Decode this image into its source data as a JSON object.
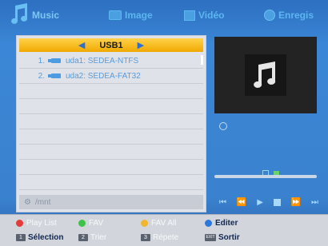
{
  "tabs": [
    {
      "label": "Music",
      "icon": "music-note-icon"
    },
    {
      "label": "Image",
      "icon": "image-icon"
    },
    {
      "label": "Vidéo",
      "icon": "video-icon"
    },
    {
      "label": "Enregis",
      "icon": "record-icon"
    }
  ],
  "device": {
    "label": "USB1"
  },
  "files": [
    {
      "index": "1.",
      "name": "uda1: SEDEA-NTFS"
    },
    {
      "index": "2.",
      "name": "uda2: SEDEA-FAT32"
    }
  ],
  "path": "/mnt",
  "legend": {
    "play_list": "Play List",
    "fav": "FAV",
    "fav_all": "FAV All",
    "editer": "Editer",
    "selection": "Sélection",
    "trier": "Trier",
    "repete": "Répete",
    "sortir": "Sortir",
    "key1": "1",
    "key2": "2",
    "key3": "3",
    "exit_key": "EXIT"
  },
  "colors": {
    "red": "#e43b3b",
    "green": "#3fc24a",
    "yellow": "#f0b630",
    "blue": "#2f78d9"
  }
}
